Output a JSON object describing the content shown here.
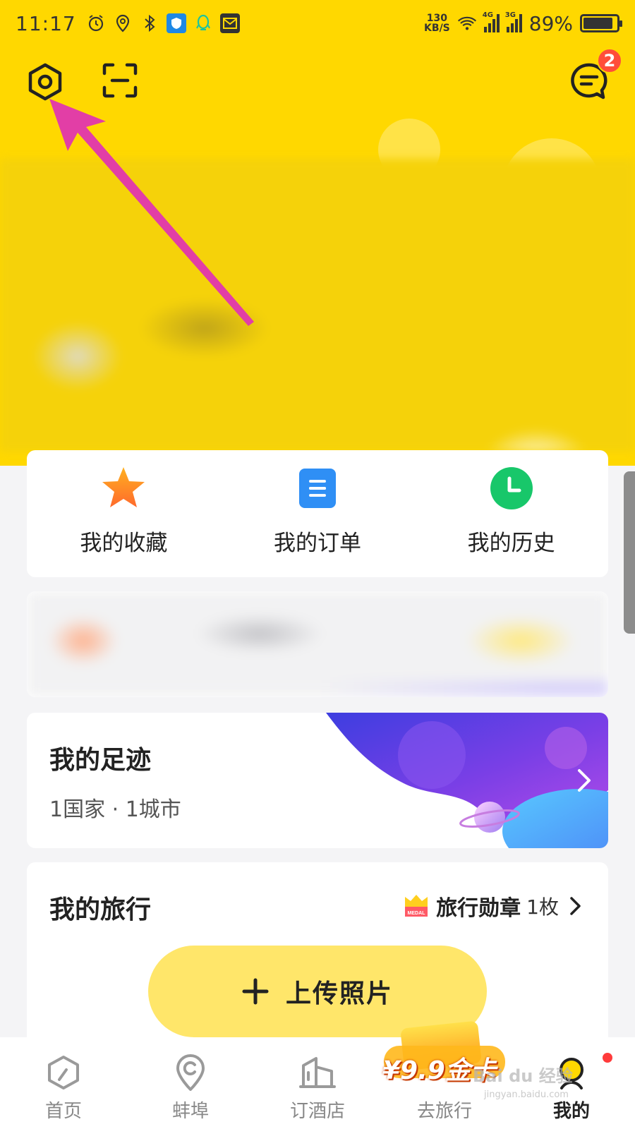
{
  "status_bar": {
    "time": "11:17",
    "net_speed_value": "130",
    "net_speed_unit": "KB/S",
    "signal1_label": "4G",
    "signal2_label": "3G",
    "battery": "89%",
    "battery_level": 0.89
  },
  "header": {
    "message_badge": "2"
  },
  "quick_access": [
    {
      "label": "我的收藏",
      "icon": "star-icon"
    },
    {
      "label": "我的订单",
      "icon": "order-icon"
    },
    {
      "label": "我的历史",
      "icon": "clock-icon"
    }
  ],
  "footprint": {
    "title": "我的足迹",
    "stats": "1国家 · 1城市"
  },
  "travel": {
    "title": "我的旅行",
    "medal_label": "旅行勋章",
    "medal_count": "1枚",
    "medal_badge_text": "MEDAL",
    "upload_label": "上传照片"
  },
  "bottom_nav": [
    {
      "label": "首页",
      "icon": "home-icon"
    },
    {
      "label": "蚌埠",
      "icon": "location-icon"
    },
    {
      "label": "订酒店",
      "icon": "hotel-icon"
    },
    {
      "label": "去旅行",
      "icon": "travel-icon"
    },
    {
      "label": "我的",
      "icon": "profile-icon",
      "active": true
    }
  ],
  "promo": {
    "text": "¥9.9金卡"
  },
  "watermark": {
    "main": "Bai du 经验",
    "sub": "jingyan.baidu.com"
  },
  "colors": {
    "brand_yellow": "#ffd800",
    "annotation_arrow": "#e23ea6",
    "badge_red": "#ff4d3a"
  }
}
